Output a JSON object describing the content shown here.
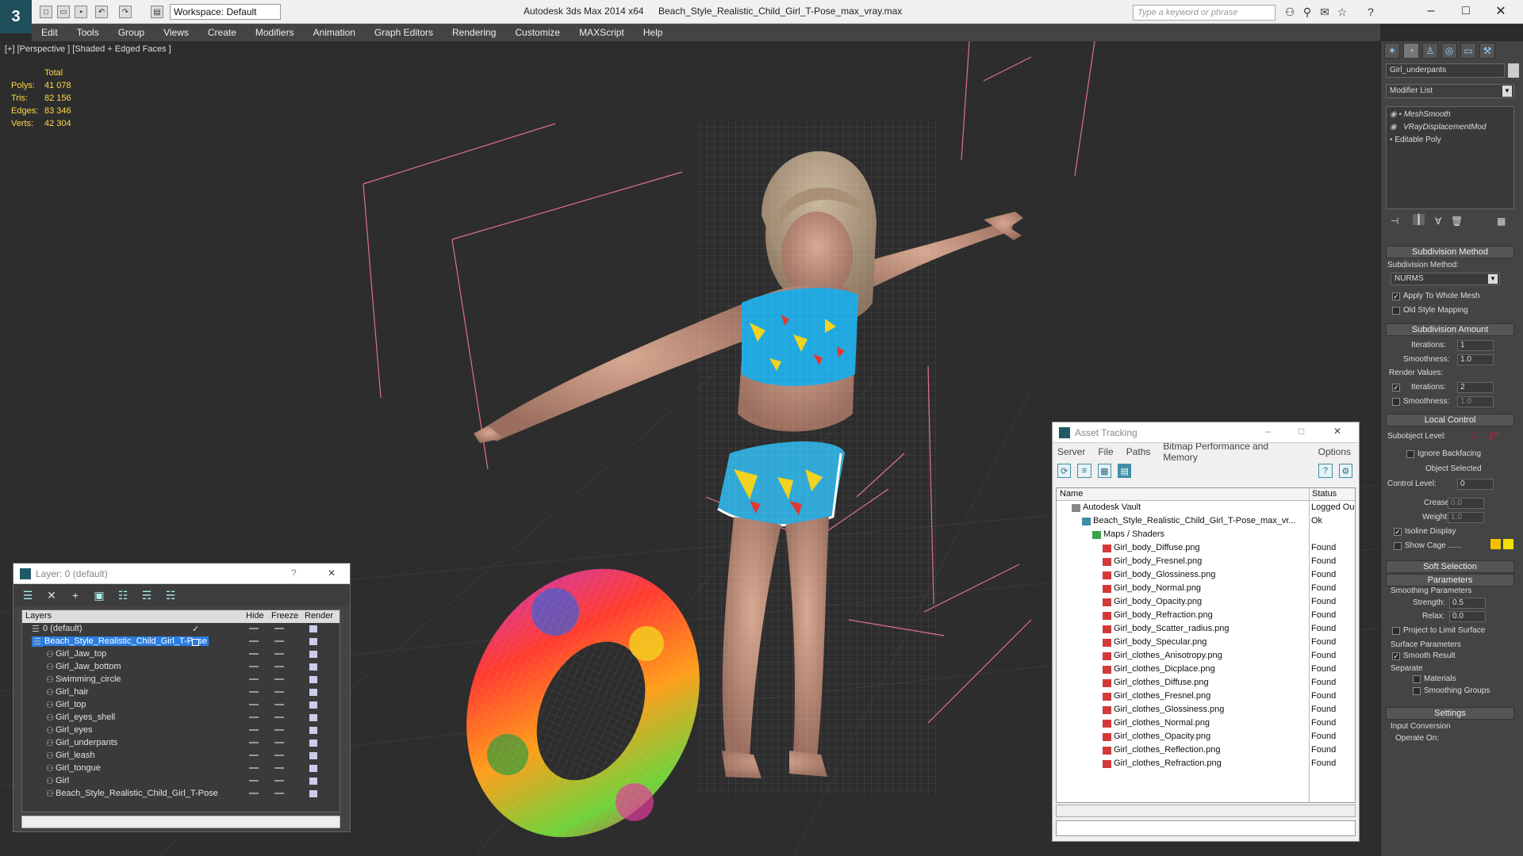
{
  "titlebar": {
    "workspace": "Workspace: Default",
    "app_name": "Autodesk 3ds Max  2014 x64",
    "file_name": "Beach_Style_Realistic_Child_Girl_T-Pose_max_vray.max",
    "search_placeholder": "Type a keyword or phrase"
  },
  "menu": [
    "Edit",
    "Tools",
    "Group",
    "Views",
    "Create",
    "Modifiers",
    "Animation",
    "Graph Editors",
    "Rendering",
    "Customize",
    "MAXScript",
    "Help"
  ],
  "viewport": {
    "label": "[+] [Perspective ] [Shaded + Edged Faces ]",
    "stats": {
      "header": "Total",
      "rows": [
        {
          "k": "Polys:",
          "v": "41 078"
        },
        {
          "k": "Tris:",
          "v": "82 156"
        },
        {
          "k": "Edges:",
          "v": "83 346"
        },
        {
          "k": "Verts:",
          "v": "42 304"
        }
      ]
    }
  },
  "layer_window": {
    "title": "Layer: 0 (default)",
    "help": "?",
    "close": "✕",
    "headers": {
      "layers": "Layers",
      "hide": "Hide",
      "freeze": "Freeze",
      "render": "Render"
    },
    "rows": [
      {
        "name": "0 (default)",
        "indent": 1,
        "check": "✓"
      },
      {
        "name": "Beach_Style_Realistic_Child_Girl_T-Pose",
        "indent": 1,
        "selected": true
      },
      {
        "name": "Girl_Jaw_top",
        "indent": 2
      },
      {
        "name": "Girl_Jaw_bottom",
        "indent": 2
      },
      {
        "name": "Swimming_circle",
        "indent": 2
      },
      {
        "name": "Girl_hair",
        "indent": 2
      },
      {
        "name": "Girl_top",
        "indent": 2
      },
      {
        "name": "Girl_eyes_shell",
        "indent": 2
      },
      {
        "name": "Girl_eyes",
        "indent": 2
      },
      {
        "name": "Girl_underpants",
        "indent": 2
      },
      {
        "name": "Girl_leash",
        "indent": 2
      },
      {
        "name": "Girl_tongue",
        "indent": 2
      },
      {
        "name": "Girl",
        "indent": 2
      },
      {
        "name": "Beach_Style_Realistic_Child_Girl_T-Pose",
        "indent": 2
      }
    ]
  },
  "asset_tracking": {
    "title": "Asset Tracking",
    "menu": [
      "Server",
      "File",
      "Paths",
      "Bitmap Performance and Memory",
      "Options"
    ],
    "headers": {
      "name": "Name",
      "status": "Status"
    },
    "rows": [
      {
        "name": "Autodesk Vault",
        "status": "Logged Ou",
        "indent": 1,
        "icon": "vault"
      },
      {
        "name": "Beach_Style_Realistic_Child_Girl_T-Pose_max_vr...",
        "status": "Ok",
        "indent": 2,
        "icon": "max"
      },
      {
        "name": "Maps / Shaders",
        "status": "",
        "indent": 3,
        "icon": "folder"
      },
      {
        "name": "Girl_body_Diffuse.png",
        "status": "Found",
        "indent": 4,
        "icon": "png"
      },
      {
        "name": "Girl_body_Fresnel.png",
        "status": "Found",
        "indent": 4,
        "icon": "png"
      },
      {
        "name": "Girl_body_Glossiness.png",
        "status": "Found",
        "indent": 4,
        "icon": "png"
      },
      {
        "name": "Girl_body_Normal.png",
        "status": "Found",
        "indent": 4,
        "icon": "png"
      },
      {
        "name": "Girl_body_Opacity.png",
        "status": "Found",
        "indent": 4,
        "icon": "png"
      },
      {
        "name": "Girl_body_Refraction.png",
        "status": "Found",
        "indent": 4,
        "icon": "png"
      },
      {
        "name": "Girl_body_Scatter_radius.png",
        "status": "Found",
        "indent": 4,
        "icon": "png"
      },
      {
        "name": "Girl_body_Specular.png",
        "status": "Found",
        "indent": 4,
        "icon": "png"
      },
      {
        "name": "Girl_clothes_Anisotropy.png",
        "status": "Found",
        "indent": 4,
        "icon": "png"
      },
      {
        "name": "Girl_clothes_Dicplace.png",
        "status": "Found",
        "indent": 4,
        "icon": "png"
      },
      {
        "name": "Girl_clothes_Diffuse.png",
        "status": "Found",
        "indent": 4,
        "icon": "png"
      },
      {
        "name": "Girl_clothes_Fresnel.png",
        "status": "Found",
        "indent": 4,
        "icon": "png"
      },
      {
        "name": "Girl_clothes_Glossiness.png",
        "status": "Found",
        "indent": 4,
        "icon": "png"
      },
      {
        "name": "Girl_clothes_Normal.png",
        "status": "Found",
        "indent": 4,
        "icon": "png"
      },
      {
        "name": "Girl_clothes_Opacity.png",
        "status": "Found",
        "indent": 4,
        "icon": "png"
      },
      {
        "name": "Girl_clothes_Reflection.png",
        "status": "Found",
        "indent": 4,
        "icon": "png"
      },
      {
        "name": "Girl_clothes_Refraction.png",
        "status": "Found",
        "indent": 4,
        "icon": "png"
      }
    ]
  },
  "command_panel": {
    "object_name": "Girl_underpants",
    "modifier_list": "Modifier List",
    "stack": [
      "MeshSmooth",
      "VRayDisplacementMod",
      "Editable Poly"
    ],
    "rollouts": {
      "subdivision_method": "Subdivision Method",
      "subdivision_method_label": "Subdivision Method:",
      "method_value": "NURMS",
      "apply_whole_mesh": "Apply To Whole Mesh",
      "old_style_mapping": "Old Style Mapping",
      "subdivision_amount": "Subdivision Amount",
      "iterations_label": "Iterations:",
      "iterations_value": "1",
      "smoothness_label": "Smoothness:",
      "smoothness_value": "1.0",
      "render_values": "Render Values:",
      "render_iterations_value": "2",
      "render_smoothness_value": "1.0",
      "local_control": "Local Control",
      "subobject_level": "Subobject Level:",
      "ignore_backfacing": "Ignore Backfacing",
      "object_selected": "Object Selected",
      "control_level": "Control Level:",
      "control_level_value": "0",
      "crease": "Crease:",
      "crease_value": "0.0",
      "weight": "Weight:",
      "weight_value": "1.0",
      "isoline_display": "Isoline Display",
      "show_cage": "Show Cage ......",
      "soft_selection": "Soft Selection",
      "parameters": "Parameters",
      "smoothing_parameters": "Smoothing Parameters",
      "strength": "Strength:",
      "strength_value": "0.5",
      "relax": "Relax:",
      "relax_value": "0.0",
      "project_limit": "Project to Limit Surface",
      "surface_parameters": "Surface Parameters",
      "smooth_result": "Smooth Result",
      "separate": "Separate",
      "materials": "Materials",
      "smoothing_groups": "Smoothing Groups",
      "settings": "Settings",
      "input_conversion": "Input Conversion",
      "operate_on": "Operate On:"
    },
    "cage_colors": [
      "#f2c200",
      "#f2e000"
    ]
  },
  "colors": {
    "accent": "#2a7de1",
    "stats": "#ffd84a",
    "bbox": "#e0708c"
  }
}
